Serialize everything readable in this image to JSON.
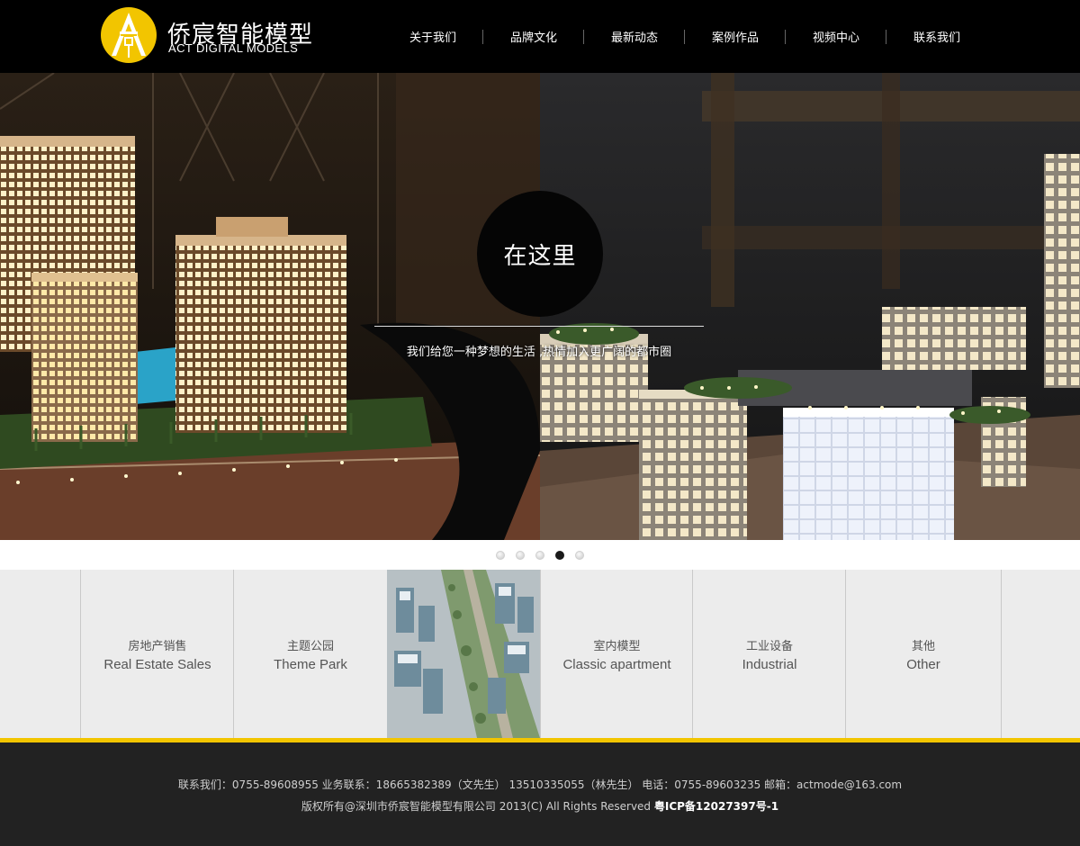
{
  "brand": {
    "name_cn": "侨宸智能模型",
    "name_en": "ACT DIGITAL MODELS"
  },
  "nav": {
    "items": [
      {
        "label": "关于我们"
      },
      {
        "label": "品牌文化"
      },
      {
        "label": "最新动态"
      },
      {
        "label": "案例作品"
      },
      {
        "label": "视频中心"
      },
      {
        "label": "联系我们"
      }
    ]
  },
  "hero": {
    "title": "在这里",
    "subtitle": "我们给您一种梦想的生活 ,热情加入更广阔的都市圈",
    "slides_total": 5,
    "active_slide_number": 4
  },
  "categories": [
    {
      "cn": "房地产销售",
      "en": "Real Estate Sales"
    },
    {
      "cn": "主题公园",
      "en": "Theme Park"
    },
    {
      "cn": "室内模型",
      "en": "Classic apartment"
    },
    {
      "cn": "工业设备",
      "en": "Industrial"
    },
    {
      "cn": "其他",
      "en": "Other"
    }
  ],
  "footer": {
    "contact_line": "联系我们：0755-89608955 业务联系：18665382389（文先生） 13510335055（林先生） 电话：0755-89603235 邮箱：actmode@163.com",
    "copyright": "版权所有@深圳市侨宸智能模型有限公司 2013(C) All Rights Reserved ",
    "icp": "粤ICP备12027397号-1"
  },
  "colors": {
    "accent": "#f2c500",
    "header_bg": "#000000",
    "footer_bg": "#222222",
    "category_bg": "#ececec"
  }
}
